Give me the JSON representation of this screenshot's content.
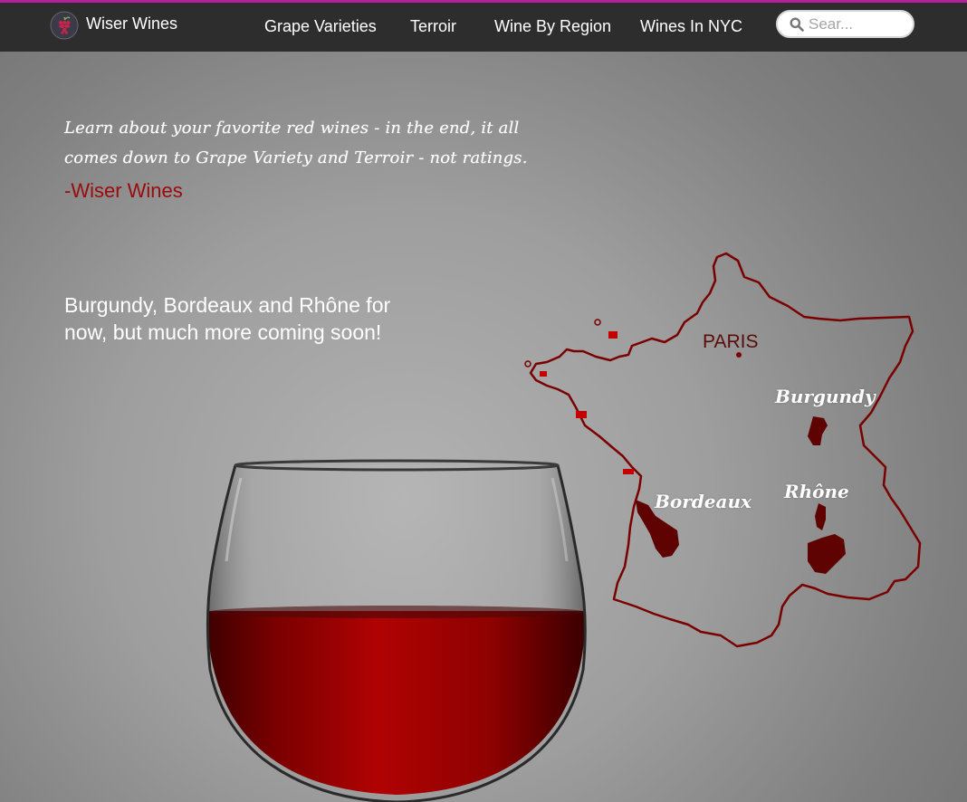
{
  "brand": {
    "name": "Wiser Wines",
    "logo_icon": "grape-icon",
    "accent": "#b41f9a"
  },
  "nav": {
    "links": [
      "Grape Varieties",
      "Terroir",
      "Wine By Region",
      "Wines In NYC"
    ]
  },
  "search": {
    "placeholder": "Sear...",
    "value": "",
    "icon": "search-icon"
  },
  "hero": {
    "quote": "Learn about your favorite red wines - in the end, it all comes down to Grape Variety and Terroir - not ratings.",
    "signature": "-Wiser Wines",
    "signature_color": "#9a0b0b",
    "subtext": "Burgundy, Bordeaux and Rhône for now, but much more coming soon!"
  },
  "map": {
    "city": "PARIS",
    "regions": [
      "Burgundy",
      "Bordeaux",
      "Rhône"
    ],
    "region_color": "#5e0202"
  }
}
